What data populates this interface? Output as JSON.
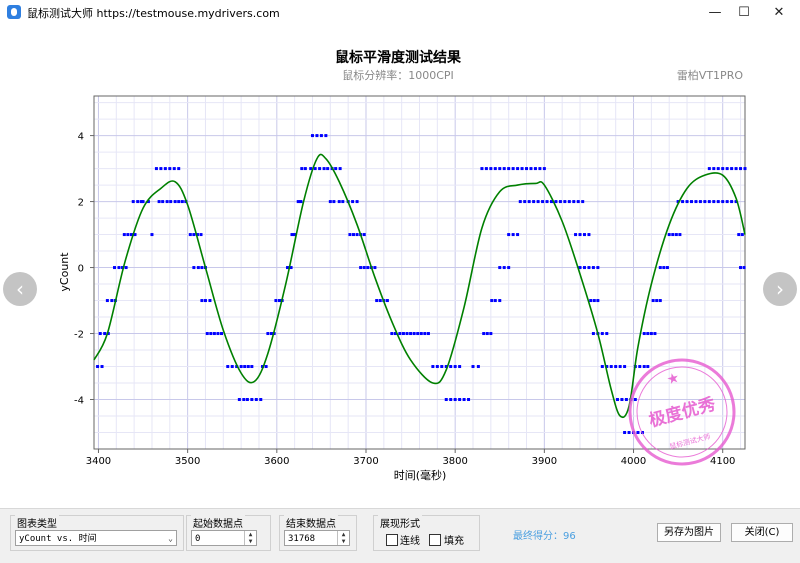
{
  "window": {
    "title": "鼠标测试大师 https://testmouse.mydrivers.com",
    "minimize": "—",
    "maximize": "☐",
    "close": "✕"
  },
  "chart": {
    "title": "鼠标平滑度测试结果",
    "subtitle": "鼠标分辨率：1000CPI",
    "device": "雷柏VT1PRO",
    "stamp": {
      "top_text": "极度优秀",
      "bottom_text": "鼠标测试大师"
    }
  },
  "chart_data": {
    "type": "scatter",
    "xlabel": "时间(毫秒)",
    "ylabel": "yCount",
    "xlim": [
      3395,
      4125
    ],
    "ylim": [
      -5.5,
      5.2
    ],
    "x_ticks": [
      3400,
      3500,
      3600,
      3700,
      3800,
      3900,
      4000,
      4100
    ],
    "y_ticks": [
      4,
      2,
      0,
      -2,
      -4
    ],
    "grid": true,
    "series": [
      {
        "name": "",
        "kind": "points",
        "color": "#0000ff",
        "points": [
          [
            3399,
            -3
          ],
          [
            3404,
            -3
          ],
          [
            3402,
            -2
          ],
          [
            3407,
            -2
          ],
          [
            3411,
            -2
          ],
          [
            3410,
            -1
          ],
          [
            3415,
            -1
          ],
          [
            3419,
            -1
          ],
          [
            3418,
            0
          ],
          [
            3423,
            0
          ],
          [
            3427,
            0
          ],
          [
            3431,
            0
          ],
          [
            3429,
            1
          ],
          [
            3433,
            1
          ],
          [
            3437,
            1
          ],
          [
            3441,
            1
          ],
          [
            3439,
            2
          ],
          [
            3444,
            2
          ],
          [
            3448,
            2
          ],
          [
            3450,
            2
          ],
          [
            3456,
            2
          ],
          [
            3460,
            1
          ],
          [
            3465,
            3
          ],
          [
            3470,
            3
          ],
          [
            3475,
            3
          ],
          [
            3480,
            3
          ],
          [
            3485,
            3
          ],
          [
            3490,
            3
          ],
          [
            3468,
            2
          ],
          [
            3472,
            2
          ],
          [
            3477,
            2
          ],
          [
            3481,
            2
          ],
          [
            3486,
            2
          ],
          [
            3490,
            2
          ],
          [
            3494,
            2
          ],
          [
            3498,
            2
          ],
          [
            3503,
            1
          ],
          [
            3507,
            1
          ],
          [
            3511,
            1
          ],
          [
            3515,
            1
          ],
          [
            3507,
            0
          ],
          [
            3512,
            0
          ],
          [
            3516,
            0
          ],
          [
            3520,
            0
          ],
          [
            3516,
            -1
          ],
          [
            3520,
            -1
          ],
          [
            3525,
            -1
          ],
          [
            3522,
            -2
          ],
          [
            3526,
            -2
          ],
          [
            3530,
            -2
          ],
          [
            3534,
            -2
          ],
          [
            3538,
            -2
          ],
          [
            3545,
            -3
          ],
          [
            3550,
            -3
          ],
          [
            3555,
            -3
          ],
          [
            3560,
            -3
          ],
          [
            3564,
            -3
          ],
          [
            3568,
            -3
          ],
          [
            3572,
            -3
          ],
          [
            3558,
            -4
          ],
          [
            3563,
            -4
          ],
          [
            3567,
            -4
          ],
          [
            3572,
            -4
          ],
          [
            3577,
            -4
          ],
          [
            3582,
            -4
          ],
          [
            3584,
            -3
          ],
          [
            3588,
            -3
          ],
          [
            3590,
            -2
          ],
          [
            3594,
            -2
          ],
          [
            3597,
            -2
          ],
          [
            3599,
            -1
          ],
          [
            3603,
            -1
          ],
          [
            3606,
            -1
          ],
          [
            3612,
            0
          ],
          [
            3616,
            0
          ],
          [
            3617,
            1
          ],
          [
            3620,
            1
          ],
          [
            3624,
            2
          ],
          [
            3627,
            2
          ],
          [
            3628,
            3
          ],
          [
            3632,
            3
          ],
          [
            3640,
            4
          ],
          [
            3645,
            4
          ],
          [
            3650,
            4
          ],
          [
            3655,
            4
          ],
          [
            3638,
            3
          ],
          [
            3643,
            3
          ],
          [
            3648,
            3
          ],
          [
            3653,
            3
          ],
          [
            3657,
            3
          ],
          [
            3662,
            3
          ],
          [
            3666,
            3
          ],
          [
            3671,
            3
          ],
          [
            3660,
            2
          ],
          [
            3664,
            2
          ],
          [
            3670,
            2
          ],
          [
            3674,
            2
          ],
          [
            3680,
            2
          ],
          [
            3685,
            2
          ],
          [
            3690,
            2
          ],
          [
            3682,
            1
          ],
          [
            3686,
            1
          ],
          [
            3690,
            1
          ],
          [
            3694,
            1
          ],
          [
            3698,
            1
          ],
          [
            3694,
            0
          ],
          [
            3698,
            0
          ],
          [
            3702,
            0
          ],
          [
            3706,
            0
          ],
          [
            3710,
            0
          ],
          [
            3712,
            -1
          ],
          [
            3716,
            -1
          ],
          [
            3720,
            -1
          ],
          [
            3724,
            -1
          ],
          [
            3729,
            -2
          ],
          [
            3733,
            -2
          ],
          [
            3738,
            -2
          ],
          [
            3742,
            -2
          ],
          [
            3746,
            -2
          ],
          [
            3750,
            -2
          ],
          [
            3754,
            -2
          ],
          [
            3758,
            -2
          ],
          [
            3762,
            -2
          ],
          [
            3766,
            -2
          ],
          [
            3770,
            -2
          ],
          [
            3775,
            -3
          ],
          [
            3780,
            -3
          ],
          [
            3785,
            -3
          ],
          [
            3790,
            -3
          ],
          [
            3795,
            -3
          ],
          [
            3800,
            -3
          ],
          [
            3805,
            -3
          ],
          [
            3790,
            -4
          ],
          [
            3795,
            -4
          ],
          [
            3800,
            -4
          ],
          [
            3805,
            -4
          ],
          [
            3810,
            -4
          ],
          [
            3815,
            -4
          ],
          [
            3820,
            -3
          ],
          [
            3826,
            -3
          ],
          [
            3832,
            -2
          ],
          [
            3836,
            -2
          ],
          [
            3840,
            -2
          ],
          [
            3841,
            -1
          ],
          [
            3845,
            -1
          ],
          [
            3850,
            -1
          ],
          [
            3850,
            0
          ],
          [
            3855,
            0
          ],
          [
            3860,
            0
          ],
          [
            3860,
            1
          ],
          [
            3865,
            1
          ],
          [
            3870,
            1
          ],
          [
            3873,
            2
          ],
          [
            3878,
            2
          ],
          [
            3830,
            3
          ],
          [
            3835,
            3
          ],
          [
            3840,
            3
          ],
          [
            3845,
            3
          ],
          [
            3850,
            3
          ],
          [
            3855,
            3
          ],
          [
            3860,
            3
          ],
          [
            3865,
            3
          ],
          [
            3870,
            3
          ],
          [
            3875,
            3
          ],
          [
            3880,
            3
          ],
          [
            3885,
            3
          ],
          [
            3890,
            3
          ],
          [
            3895,
            3
          ],
          [
            3900,
            3
          ],
          [
            3883,
            2
          ],
          [
            3888,
            2
          ],
          [
            3893,
            2
          ],
          [
            3898,
            2
          ],
          [
            3903,
            2
          ],
          [
            3908,
            2
          ],
          [
            3913,
            2
          ],
          [
            3918,
            2
          ],
          [
            3923,
            2
          ],
          [
            3928,
            2
          ],
          [
            3933,
            2
          ],
          [
            3938,
            2
          ],
          [
            3943,
            2
          ],
          [
            3935,
            1
          ],
          [
            3940,
            1
          ],
          [
            3945,
            1
          ],
          [
            3950,
            1
          ],
          [
            3940,
            0
          ],
          [
            3945,
            0
          ],
          [
            3950,
            0
          ],
          [
            3955,
            0
          ],
          [
            3960,
            0
          ],
          [
            3952,
            -1
          ],
          [
            3956,
            -1
          ],
          [
            3960,
            -1
          ],
          [
            3955,
            -2
          ],
          [
            3960,
            -2
          ],
          [
            3965,
            -2
          ],
          [
            3970,
            -2
          ],
          [
            3965,
            -3
          ],
          [
            3970,
            -3
          ],
          [
            3975,
            -3
          ],
          [
            3980,
            -3
          ],
          [
            3985,
            -3
          ],
          [
            3990,
            -3
          ],
          [
            3982,
            -4
          ],
          [
            3987,
            -4
          ],
          [
            3992,
            -4
          ],
          [
            3997,
            -4
          ],
          [
            4002,
            -4
          ],
          [
            3990,
            -5
          ],
          [
            3995,
            -5
          ],
          [
            4000,
            -5
          ],
          [
            4005,
            -5
          ],
          [
            4010,
            -5
          ],
          [
            4002,
            -3
          ],
          [
            4007,
            -3
          ],
          [
            4012,
            -3
          ],
          [
            4016,
            -3
          ],
          [
            4012,
            -2
          ],
          [
            4016,
            -2
          ],
          [
            4020,
            -2
          ],
          [
            4024,
            -2
          ],
          [
            4022,
            -1
          ],
          [
            4026,
            -1
          ],
          [
            4030,
            -1
          ],
          [
            4030,
            0
          ],
          [
            4034,
            0
          ],
          [
            4038,
            0
          ],
          [
            4040,
            1
          ],
          [
            4044,
            1
          ],
          [
            4048,
            1
          ],
          [
            4052,
            1
          ],
          [
            4050,
            2
          ],
          [
            4055,
            2
          ],
          [
            4060,
            2
          ],
          [
            4065,
            2
          ],
          [
            4070,
            2
          ],
          [
            4075,
            2
          ],
          [
            4080,
            2
          ],
          [
            4085,
            2
          ],
          [
            4090,
            2
          ],
          [
            4095,
            2
          ],
          [
            4100,
            2
          ],
          [
            4105,
            2
          ],
          [
            4110,
            2
          ],
          [
            4115,
            2
          ],
          [
            4085,
            3
          ],
          [
            4090,
            3
          ],
          [
            4095,
            3
          ],
          [
            4100,
            3
          ],
          [
            4105,
            3
          ],
          [
            4110,
            3
          ],
          [
            4115,
            3
          ],
          [
            4120,
            3
          ],
          [
            4125,
            3
          ],
          [
            4118,
            1
          ],
          [
            4122,
            1
          ],
          [
            4120,
            0
          ],
          [
            4124,
            0
          ]
        ]
      },
      {
        "name": "",
        "kind": "line",
        "color": "#008000",
        "points": [
          [
            3395,
            -2.8
          ],
          [
            3410,
            -2.0
          ],
          [
            3430,
            0.2
          ],
          [
            3450,
            1.8
          ],
          [
            3470,
            2.4
          ],
          [
            3486,
            2.6
          ],
          [
            3500,
            1.9
          ],
          [
            3520,
            0.0
          ],
          [
            3540,
            -1.9
          ],
          [
            3560,
            -3.2
          ],
          [
            3575,
            -3.45
          ],
          [
            3590,
            -2.6
          ],
          [
            3610,
            -0.5
          ],
          [
            3630,
            2.0
          ],
          [
            3645,
            3.3
          ],
          [
            3655,
            3.3
          ],
          [
            3670,
            2.6
          ],
          [
            3690,
            1.3
          ],
          [
            3710,
            -0.3
          ],
          [
            3730,
            -1.7
          ],
          [
            3750,
            -2.8
          ],
          [
            3775,
            -3.5
          ],
          [
            3790,
            -3.1
          ],
          [
            3810,
            -1.2
          ],
          [
            3830,
            1.2
          ],
          [
            3850,
            2.3
          ],
          [
            3870,
            2.5
          ],
          [
            3890,
            2.55
          ],
          [
            3900,
            2.5
          ],
          [
            3920,
            1.4
          ],
          [
            3940,
            -0.2
          ],
          [
            3960,
            -2.0
          ],
          [
            3975,
            -3.7
          ],
          [
            3985,
            -4.5
          ],
          [
            3995,
            -4.2
          ],
          [
            4005,
            -2.4
          ],
          [
            4020,
            -0.5
          ],
          [
            4040,
            1.3
          ],
          [
            4060,
            2.4
          ],
          [
            4080,
            2.8
          ],
          [
            4100,
            2.8
          ],
          [
            4115,
            2.1
          ],
          [
            4125,
            1.0
          ]
        ]
      }
    ]
  },
  "nav": {
    "prev_icon": "‹",
    "next_icon": "›"
  },
  "controls": {
    "chart_type": {
      "label": "图表类型",
      "value": "yCount vs. 时间"
    },
    "start_point": {
      "label": "起始数据点",
      "value": "0"
    },
    "end_point": {
      "label": "结束数据点",
      "value": "31768"
    },
    "display": {
      "label": "展现形式",
      "line_label": "连线",
      "fill_label": "填充",
      "line_checked": false,
      "fill_checked": false
    },
    "score": "最终得分：96",
    "save_button": "另存为图片",
    "close_button": "关闭(C)"
  }
}
